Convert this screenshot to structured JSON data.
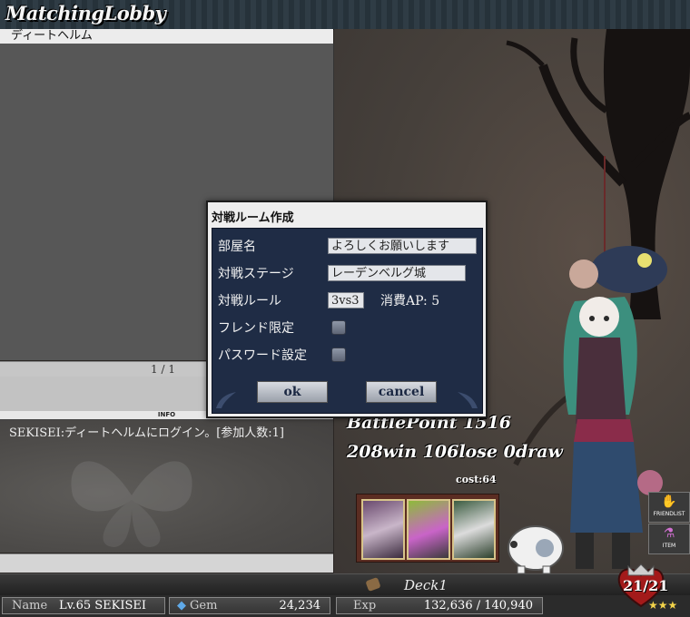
{
  "header": {
    "logo": "MatchingLobby",
    "lobby_name": "ディートヘルム"
  },
  "room_list": {
    "pagination": "1 / 1"
  },
  "info": {
    "header": "INFO",
    "messages": [
      "SEKISEI:ディートヘルムにログイン。[参加人数:1]"
    ]
  },
  "scene": {
    "battle_point": "BattlePoint 1516",
    "record": "208win 106lose 0draw",
    "cost": "cost:64",
    "side_buttons": [
      "FRIENDLIST",
      "ITEM"
    ]
  },
  "deck": {
    "name": "Deck1"
  },
  "status": {
    "name_label": "Name",
    "name_value": "Lv.65 SEKISEI",
    "gem_label": "Gem",
    "gem_value": "24,234",
    "exp_label": "Exp",
    "exp_value": "132,636 / 140,940",
    "level_badge": "21/21",
    "stars": "★★★"
  },
  "dialog": {
    "title": "対戦ルーム作成",
    "room_name_label": "部屋名",
    "room_name_value": "よろしくお願いします",
    "stage_label": "対戦ステージ",
    "stage_value": "レーデンベルグ城",
    "rule_label": "対戦ルール",
    "rule_value": "3vs3",
    "ap_cost": "消費AP: 5",
    "friend_only_label": "フレンド限定",
    "password_label": "パスワード設定",
    "ok_label": "ok",
    "cancel_label": "cancel"
  },
  "colors": {
    "dialog_body": "#1f2c45",
    "header_bg": "#2f3c45",
    "star": "#f3d34a"
  }
}
